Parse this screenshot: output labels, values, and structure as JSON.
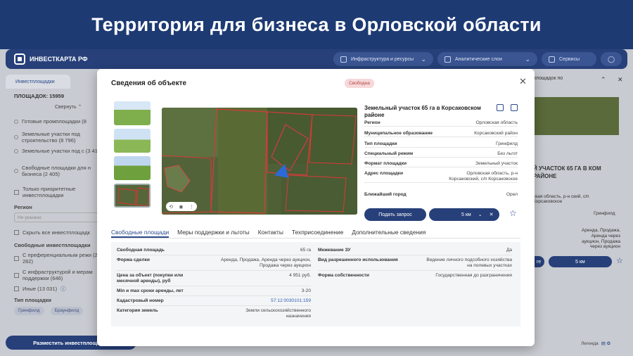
{
  "slide_title": "Территория для бизнеса в Орловской области",
  "nav": {
    "logo": "ИНВЕСТКАРТА РФ",
    "infra": "Инфраструктура и ресурсы",
    "layers": "Аналитические слои",
    "services": "Сервисы"
  },
  "left": {
    "tab": "Инвестплощадки",
    "count": "ПЛОЩАДОК: 15959",
    "collapse": "Свернуть",
    "radios": [
      "Готовые промплощадки (8",
      "Земельные участки под строительство (8 796)",
      "Земельные участки под с (3 417)",
      "Свободные площадки для н бизнеса (2 405)"
    ],
    "priority": "Только приоритетные инвестплощадки",
    "region_label": "Регион",
    "region_placeholder": "Не указано",
    "hide_all": "Скрыть все инвестплощадк",
    "free_label": "Свободные инвестплощадки",
    "checks": [
      "С преференциальным режи (2 282)",
      "С инфраструктурой и мерам поддержки (646)",
      "Иные (13 031)"
    ],
    "type_label": "Тип площадки",
    "tags": [
      "Гринфилд",
      "Браунфилд"
    ],
    "place_button": "Разместить инвестплощадку"
  },
  "right": {
    "top_text": "площадок по",
    "title": "Й УЧАСТОК 65 ГА В КОМ РАЙОНЕ",
    "address": "ская область, р-н ский, с/п Корсаковское",
    "rows": [
      [
        "",
        "Гринфилд"
      ],
      [
        "",
        ""
      ],
      [
        "",
        "Аренда, Продажа, Аренда через аукцион, Продажа через аукцион"
      ]
    ],
    "btn": "ге",
    "km": "5 км",
    "legend": "Легенда"
  },
  "modal": {
    "title": "Сведения об объекте",
    "status": "Свободна",
    "object_title": "Земельный участок 65 га в Корсаковском районе",
    "props": [
      {
        "k": "Регион",
        "v": "Орловская область"
      },
      {
        "k": "Муниципальное образование",
        "v": "Корсаковский район"
      },
      {
        "k": "Тип площадки",
        "v": "Гринфилд"
      },
      {
        "k": "Специальный режим",
        "v": "Без льгот"
      },
      {
        "k": "Формат площадки",
        "v": "Земельный участок"
      },
      {
        "k": "Адрес площадки",
        "v": "Орловская область, р-н Корсаковский, с/п Корсаковское"
      },
      {
        "k": "Ближайший город",
        "v": "Орел"
      }
    ],
    "request_button": "Подать запрос",
    "radius": "5 км",
    "tabs": [
      "Свободные площади",
      "Меры поддержки и льготы",
      "Контакты",
      "Техприсоединение",
      "Дополнительные сведения"
    ],
    "details_left": [
      {
        "k": "Свободная площадь",
        "v": "65 га"
      },
      {
        "k": "Форма сделки",
        "v": "Аренда, Продажа, Аренда через аукцион, Продажа через аукцион"
      },
      {
        "k": "Цена за объект (покупки или месячной аренды), руб",
        "v": "4 951 руб."
      },
      {
        "k": "Min и max сроки аренды, лет",
        "v": "3-20"
      },
      {
        "k": "Кадастровый номер",
        "v": "57:12:0030101:159"
      },
      {
        "k": "Категория земель",
        "v": "Земли сельскохозяйственного назначения"
      }
    ],
    "details_right": [
      {
        "k": "Межевание ЗУ",
        "v": "Да"
      },
      {
        "k": "Вид разрешенного использования",
        "v": "Ведение личного подсобного хозяйства на полевых участках"
      },
      {
        "k": "Форма собственности",
        "v": "Государственная до разграничения"
      }
    ]
  }
}
